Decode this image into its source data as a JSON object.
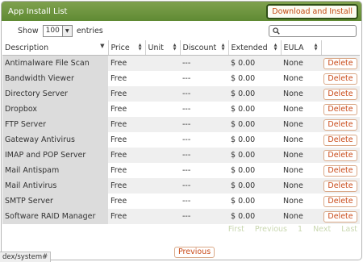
{
  "header": {
    "title": "App Install List",
    "action_label": "Download and Install"
  },
  "controls": {
    "show_label": "Show",
    "page_size": "100",
    "entries_label": "entries"
  },
  "table": {
    "columns": [
      "Description",
      "Price",
      "Unit",
      "Discount",
      "Extended",
      "EULA",
      ""
    ],
    "rows": [
      [
        "Antimalware File Scan",
        "Free",
        "",
        "---",
        "$ 0.00",
        "None",
        "Delete"
      ],
      [
        "Bandwidth Viewer",
        "Free",
        "",
        "---",
        "$ 0.00",
        "None",
        "Delete"
      ],
      [
        "Directory Server",
        "Free",
        "",
        "---",
        "$ 0.00",
        "None",
        "Delete"
      ],
      [
        "Dropbox",
        "Free",
        "",
        "---",
        "$ 0.00",
        "None",
        "Delete"
      ],
      [
        "FTP Server",
        "Free",
        "",
        "---",
        "$ 0.00",
        "None",
        "Delete"
      ],
      [
        "Gateway Antivirus",
        "Free",
        "",
        "---",
        "$ 0.00",
        "None",
        "Delete"
      ],
      [
        "IMAP and POP Server",
        "Free",
        "",
        "---",
        "$ 0.00",
        "None",
        "Delete"
      ],
      [
        "Mail Antispam",
        "Free",
        "",
        "---",
        "$ 0.00",
        "None",
        "Delete"
      ],
      [
        "Mail Antivirus",
        "Free",
        "",
        "---",
        "$ 0.00",
        "None",
        "Delete"
      ],
      [
        "SMTP Server",
        "Free",
        "",
        "---",
        "$ 0.00",
        "None",
        "Delete"
      ],
      [
        "Software RAID Manager",
        "Free",
        "",
        "---",
        "$ 0.00",
        "None",
        "Delete"
      ]
    ]
  },
  "pagination": {
    "first": "First",
    "previous": "Previous",
    "page": "1",
    "next": "Next",
    "last": "Last"
  },
  "footer": {
    "previous_button": "Previous",
    "status_text": "dex/system#"
  },
  "colors": {
    "header_green": "#6b9440",
    "accent_orange": "#c94a18"
  }
}
